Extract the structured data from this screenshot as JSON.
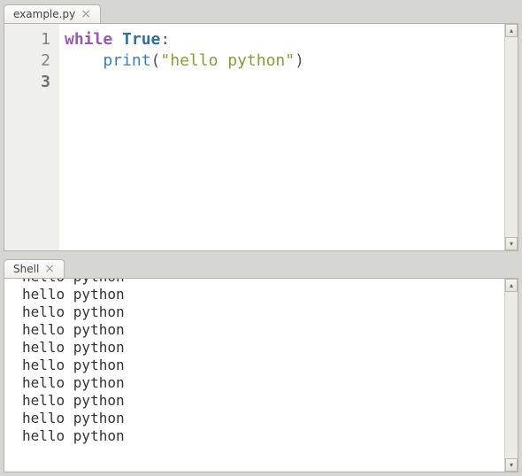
{
  "editor": {
    "tab_label": "example.py",
    "gutter_numbers": [
      "1",
      "2",
      "3"
    ],
    "current_line_index": 2,
    "line1": {
      "kw": "while",
      "sp1": " ",
      "val": "True",
      "colon": ":"
    },
    "line2": {
      "indent": "    ",
      "fn": "print",
      "lp": "(",
      "str": "\"hello python\"",
      "rp": ")"
    }
  },
  "shell": {
    "tab_label": "Shell",
    "output_line": "hello python",
    "repeat_count": 10
  },
  "icons": {
    "close": "×",
    "up": "▴",
    "down": "▾"
  }
}
